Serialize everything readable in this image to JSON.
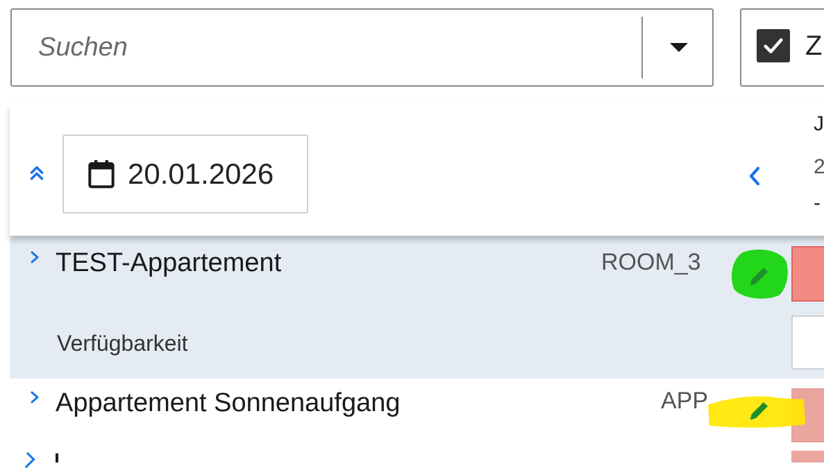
{
  "search": {
    "placeholder": "Suchen"
  },
  "checkbox": {
    "label": "Z",
    "checked": true
  },
  "date_header": {
    "date": "20.01.2026",
    "cut_line1": "J",
    "cut_line2": "2",
    "cut_line3": "-"
  },
  "rows": [
    {
      "name": "TEST-Appartement",
      "code": "ROOM_3",
      "highlight": "#22d61a"
    },
    {
      "name": "Appartement Sonnenaufgang",
      "code": "APP",
      "highlight": "#ffe600"
    }
  ],
  "subrow": {
    "label": "Verfügbarkeit"
  },
  "colors": {
    "accent": "#1a73e8",
    "row_bg": "#e4ebf3",
    "cell_red": "#f28b82",
    "edit_icon": "#1e8f2a"
  }
}
